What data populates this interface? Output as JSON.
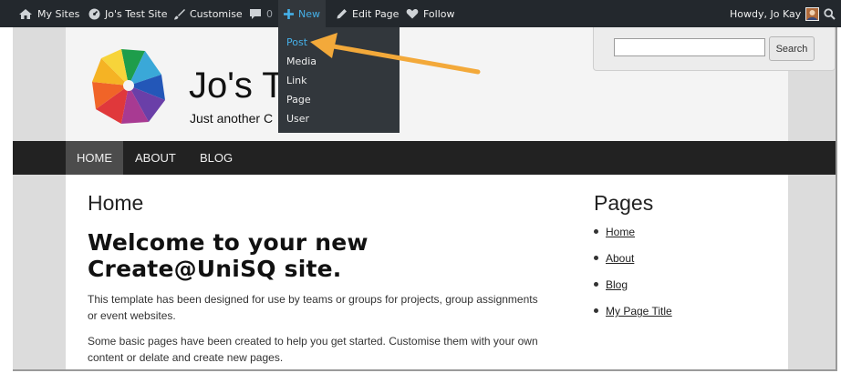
{
  "admin_bar": {
    "my_sites": "My Sites",
    "site_name": "Jo's Test Site",
    "customise": "Customise",
    "comments_count": "0",
    "new": "New",
    "edit_page": "Edit Page",
    "follow": "Follow",
    "howdy": "Howdy, Jo Kay"
  },
  "new_menu": {
    "items": [
      "Post",
      "Media",
      "Link",
      "Page",
      "User"
    ],
    "active": "Post"
  },
  "header": {
    "site_title": "Jo's T",
    "tagline": "Just another C",
    "search_button": "Search",
    "search_value": ""
  },
  "nav": {
    "items": [
      "HOME",
      "ABOUT",
      "BLOG"
    ]
  },
  "main": {
    "page_title": "Home",
    "welcome_heading": "Welcome to your new Create@UniSQ site.",
    "paragraphs": [
      "This template has been designed for use by teams or groups for projects, group assignments or event websites.",
      "Some basic pages have been created to help you get started. Customise them with your own content or delate and create new pages."
    ]
  },
  "sidebar": {
    "title": "Pages",
    "links": [
      "Home",
      "About",
      "Blog",
      "My Page Title"
    ]
  },
  "colors": {
    "admin_bar": "#23282d",
    "accent": "#45b0e8",
    "nav_bar": "#222222",
    "arrow": "#f3a93a"
  },
  "icons": {
    "my_sites": "wordpress-sites-icon",
    "site": "dashboard-icon",
    "customise": "brush-icon",
    "comments": "comment-icon",
    "new": "plus-icon",
    "edit": "pencil-icon",
    "follow": "heart-icon",
    "avatar": "avatar",
    "search": "search-icon"
  }
}
